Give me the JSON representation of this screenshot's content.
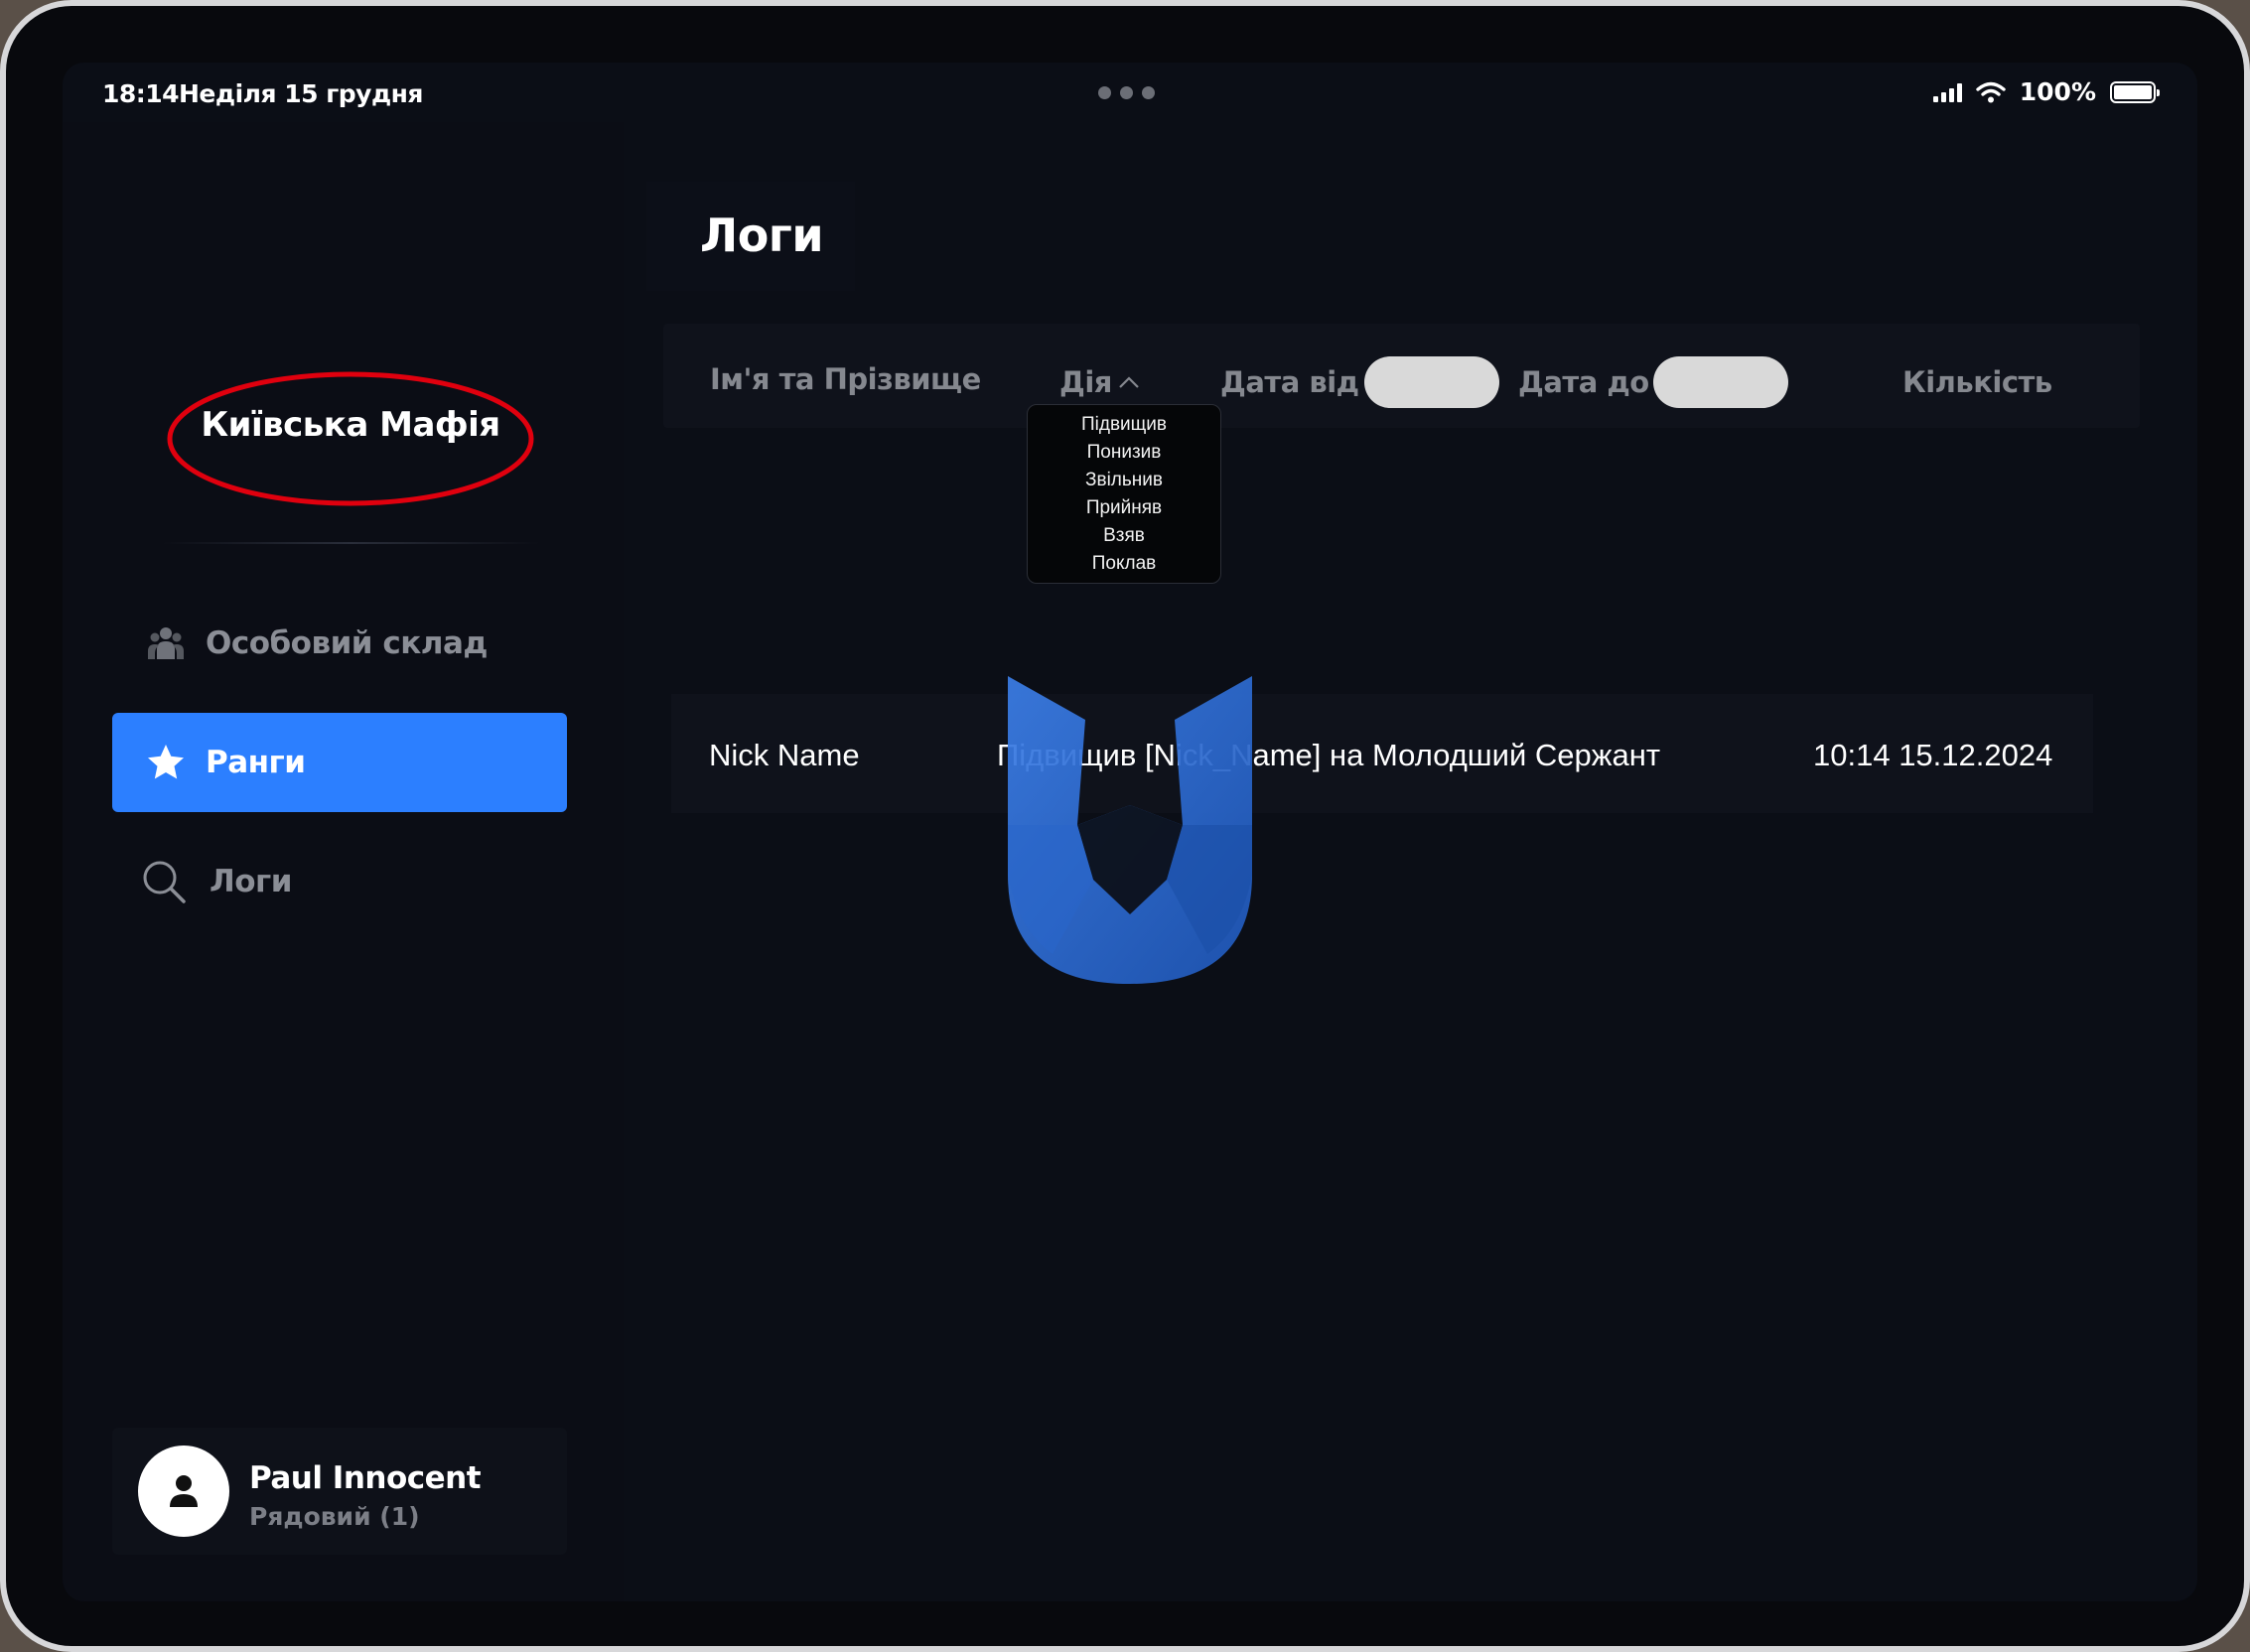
{
  "status_bar": {
    "time": "18:14",
    "date": "Неділя 15 грудня",
    "battery": "100%"
  },
  "sidebar": {
    "org_name": "Київська Мафія",
    "items": [
      {
        "label": "Особовий склад",
        "icon": "people-icon",
        "active": false
      },
      {
        "label": "Ранги",
        "icon": "star-icon",
        "active": true
      },
      {
        "label": "Логи",
        "icon": "search-icon",
        "active": false
      }
    ],
    "user": {
      "name": "Paul Innocent",
      "rank": "Рядовий (1)"
    }
  },
  "main": {
    "title": "Логи",
    "columns": {
      "name": "Ім'я та Прізвище",
      "action": "Дія",
      "date_from": "Дата від",
      "date_to": "Дата до",
      "count": "Кількість"
    },
    "action_options": [
      "Підвищив",
      "Понизив",
      "Звільнив",
      "Прийняв",
      "Взяв",
      "Поклав"
    ],
    "rows": [
      {
        "name": "Nick Name",
        "action": "Підвищив [Nick_Name] на Молодший Сержант",
        "time": "10:14 15.12.2024"
      }
    ]
  },
  "colors": {
    "accent": "#2c7fff",
    "annotation_ring": "#e0000e",
    "background": "#0b0e16",
    "logo": "#2f6fd6"
  }
}
